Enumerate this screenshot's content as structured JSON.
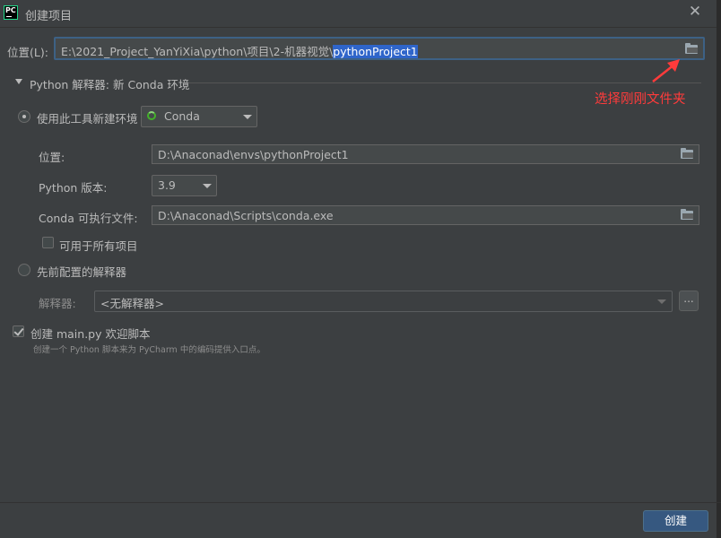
{
  "window": {
    "app_icon_text": "PC",
    "title": "创建项目"
  },
  "location": {
    "label": "位置(L):",
    "path_prefix": "E:\\2021_Project_YanYiXia\\python\\项目\\2-机器视觉\\",
    "path_selected": "pythonProject1"
  },
  "annotation": {
    "text": "选择刚刚文件夹",
    "color": "#ff3b3b"
  },
  "interpreter_section": {
    "title": "Python 解释器: 新 Conda 环境",
    "new_env": {
      "radio_label": "使用此工具新建环境",
      "selected": true,
      "tool_value": "Conda",
      "location_label": "位置:",
      "location_value": "D:\\Anaconad\\envs\\pythonProject1",
      "python_version_label": "Python 版本:",
      "python_version_value": "3.9",
      "conda_exe_label": "Conda 可执行文件:",
      "conda_exe_value": "D:\\Anaconad\\Scripts\\conda.exe",
      "all_projects_label": "可用于所有项目",
      "all_projects_checked": false
    },
    "previous": {
      "radio_label": "先前配置的解释器",
      "selected": false,
      "interpreter_label": "解释器:",
      "interpreter_value": "<无解释器>",
      "browse_label": "..."
    }
  },
  "welcome_script": {
    "label": "创建 main.py 欢迎脚本",
    "checked": true,
    "hint": "创建一个 Python 脚本来为 PyCharm 中的编码提供入口点。"
  },
  "footer": {
    "create_label": "创建"
  },
  "colors": {
    "background": "#3c3f41",
    "selection": "#2f65ca",
    "primary_button": "#365880",
    "focus_border": "#3d6185",
    "conda_green": "#43b02a"
  }
}
